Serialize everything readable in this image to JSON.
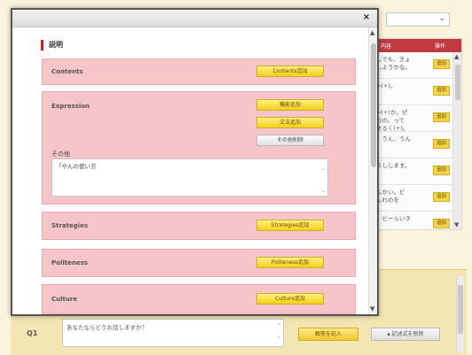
{
  "background": {
    "select": {
      "value": "",
      "chevron_icon": "chevron-down-icon"
    },
    "table": {
      "headers": [
        "内容",
        "操作"
      ],
      "rows": [
        {
          "text": "しでも、きょ\nしようかな。",
          "action": "追加"
        },
        {
          "text": "=(+)。",
          "action": "追加"
        },
        {
          "text": "=(+)か。ぜ\nおの。って\nするく(+)。",
          "action": "追加"
        },
        {
          "text": "。うん、うん",
          "action": "追加"
        },
        {
          "text": "うしします。",
          "action": "追加"
        },
        {
          "text": "んかい。ビ\nんれのを",
          "action": "追加"
        },
        {
          "text": "。ビールいき",
          "action": "追加"
        }
      ]
    },
    "question": {
      "label": "Q1",
      "text": "あなたならどうお話しますか？",
      "add_button": "解答を記入",
      "delete_button": "記述式を削除"
    }
  },
  "modal": {
    "close_symbol": "×",
    "heading": "説明",
    "contents": {
      "label": "Contents",
      "button": "Contents追加"
    },
    "expression": {
      "label": "Expression",
      "buttons": [
        "機能追加",
        "文法追加"
      ],
      "other_button": "その他削除",
      "other_label": "その他",
      "other_text": "「やんの使い方"
    },
    "strategies": {
      "label": "Strategies",
      "button": "Strategies追加"
    },
    "politeness": {
      "label": "Politeness",
      "button": "Politeness追加"
    },
    "culture": {
      "label": "Culture",
      "button": "Culture追加"
    }
  },
  "colors": {
    "accent": "#c8222b",
    "panel_pink": "#f6c5ca",
    "button_yellow": "#f4cf1c",
    "header_red": "#c03a3f",
    "page_background": "#fbf4dc"
  }
}
